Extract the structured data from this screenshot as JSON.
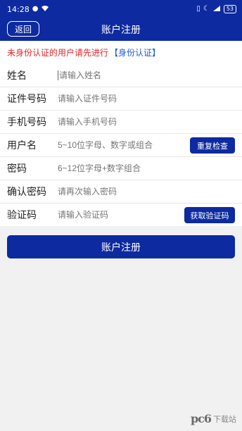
{
  "status_bar": {
    "time": "14:28",
    "battery": "53",
    "icons": [
      "notification-dot-icon",
      "wifi-icon",
      "vibrate-icon",
      "moon-icon",
      "signal-icon"
    ]
  },
  "nav": {
    "back_label": "返回",
    "title": "账户注册"
  },
  "notice": {
    "text": "未身份认证的用户请先进行",
    "link_text": "【身份认证】"
  },
  "form": {
    "rows": [
      {
        "label": "姓名",
        "placeholder": "请输入姓名"
      },
      {
        "label": "证件号码",
        "placeholder": "请输入证件号码"
      },
      {
        "label": "手机号码",
        "placeholder": "请输入手机号码"
      },
      {
        "label": "用户名",
        "placeholder": "5~10位字母、数字或组合",
        "button": "重复检查"
      },
      {
        "label": "密码",
        "placeholder": "6~12位字母+数字组合"
      },
      {
        "label": "确认密码",
        "placeholder": "请再次输入密码"
      },
      {
        "label": "验证码",
        "placeholder": "请输入验证码",
        "button": "获取验证码"
      }
    ]
  },
  "submit_label": "账户注册",
  "watermark": {
    "logo": "pc6",
    "text": "下载站"
  },
  "colors": {
    "primary": "#0d2aa0",
    "warning": "#e8252b",
    "link": "#1d5ad6"
  }
}
